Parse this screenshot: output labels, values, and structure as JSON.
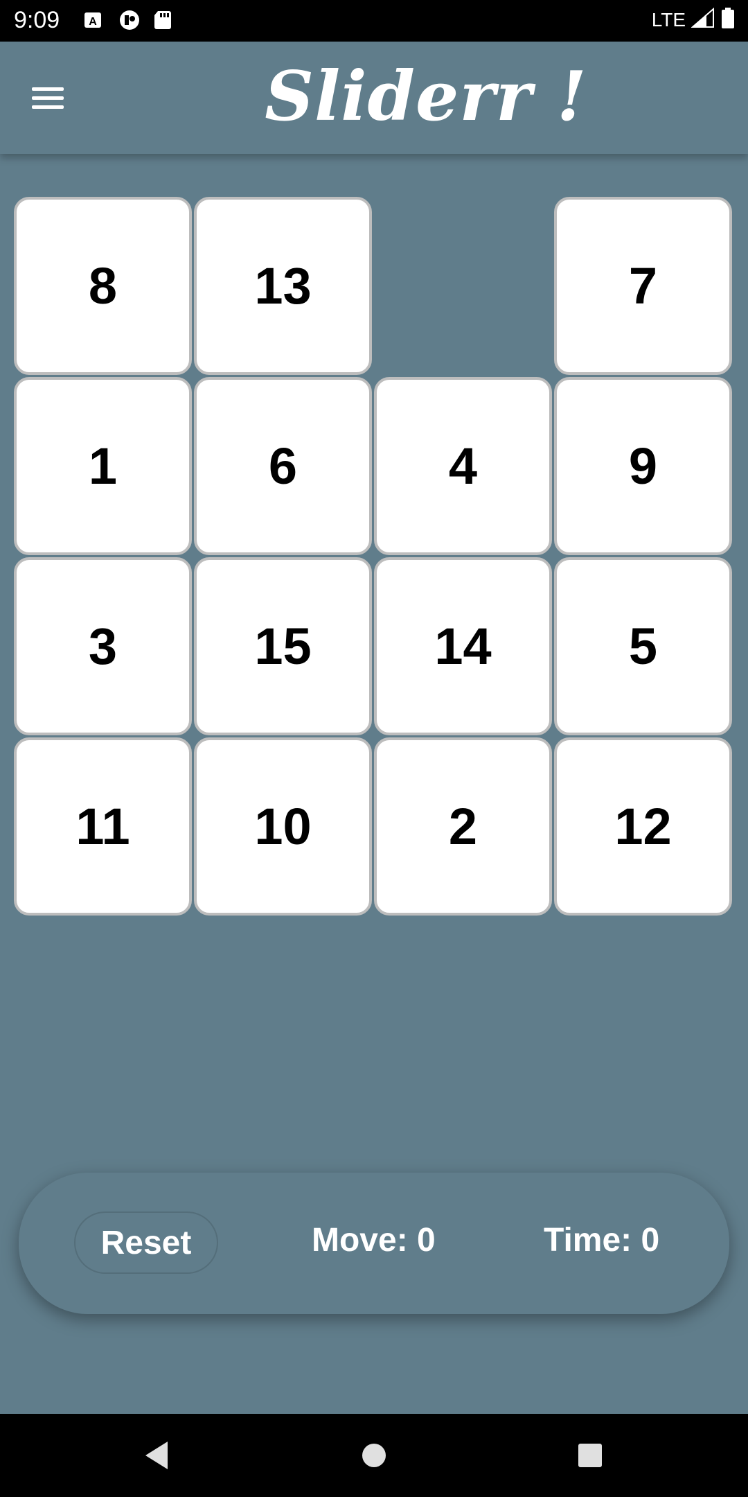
{
  "status_bar": {
    "time": "9:09",
    "network": "LTE",
    "icons": [
      "a-notification-icon",
      "record-icon",
      "sd-card-icon",
      "signal-icon",
      "battery-icon"
    ]
  },
  "app_bar": {
    "title": "Sliderr !",
    "menu_icon": "hamburger-menu-icon"
  },
  "board": {
    "size": 4,
    "tiles": [
      [
        "8",
        "13",
        "",
        "7"
      ],
      [
        "1",
        "6",
        "4",
        "9"
      ],
      [
        "3",
        "15",
        "14",
        "5"
      ],
      [
        "11",
        "10",
        "2",
        "12"
      ]
    ]
  },
  "controls": {
    "reset_label": "Reset",
    "move_label": "Move: 0",
    "time_label": "Time: 0"
  },
  "nav_bar": {
    "icons": [
      "back-icon",
      "home-icon",
      "recents-icon"
    ]
  },
  "colors": {
    "background": "#607d8b",
    "tile": "#ffffff",
    "tile_border": "#bdbdbd",
    "text_on_dark": "#ffffff"
  }
}
